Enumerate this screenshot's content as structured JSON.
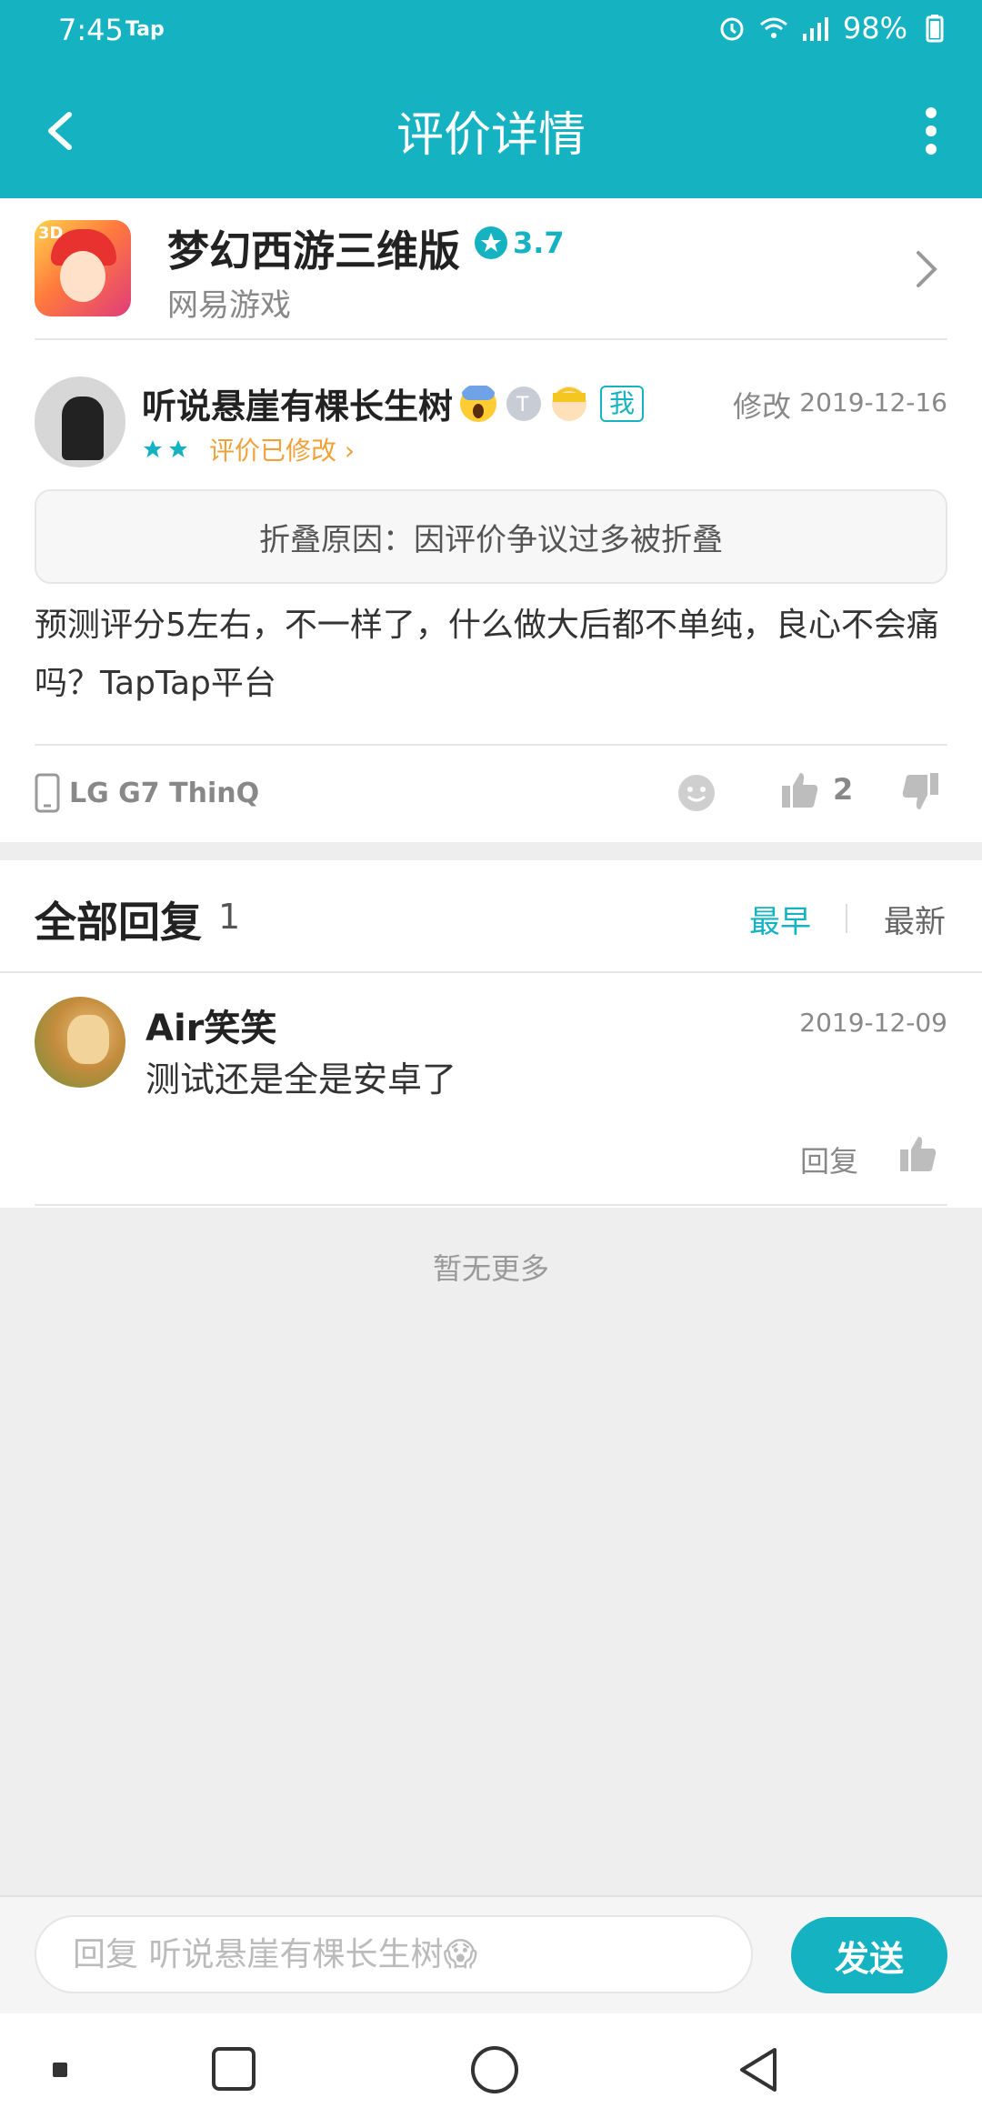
{
  "status": {
    "time": "7:45",
    "tap": "Tap",
    "battery": "98%"
  },
  "header": {
    "title": "评价详情"
  },
  "app": {
    "name": "梦幻西游三维版",
    "rating": "3.7",
    "developer": "网易游戏",
    "accent_color": "#15b2c2"
  },
  "review": {
    "username": "听说悬崖有棵长生树",
    "me_tag": "我",
    "edit_label": "修改",
    "date": "2019-12-16",
    "stars": 2,
    "modified_label": "评价已修改 ›",
    "fold_reason": "折叠原因：因评价争议过多被折叠",
    "text": "预测评分5左右，不一样了，什么做大后都不单纯，良心不会痛吗？TapTap平台",
    "device": "LG G7 ThinQ",
    "like_count": "2"
  },
  "replies": {
    "title": "全部回复",
    "count": "1",
    "sort_early": "最早",
    "sort_new": "最新",
    "items": [
      {
        "username": "Air笑笑",
        "date": "2019-12-09",
        "text": "测试还是全是安卓了",
        "reply_label": "回复"
      }
    ],
    "no_more": "暂无更多"
  },
  "composer": {
    "placeholder": "回复 听说悬崖有棵长生树😱",
    "send_label": "发送"
  }
}
